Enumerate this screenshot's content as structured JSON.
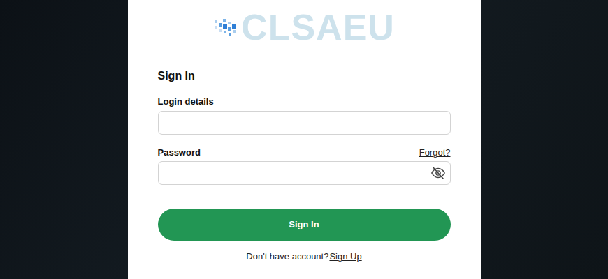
{
  "logo": {
    "text": "CLSAEU"
  },
  "sign_in": {
    "title": "Sign In",
    "login_label": "Login details",
    "login_value": "",
    "password_label": "Password",
    "forgot": "Forgot?",
    "password_visible": false,
    "button": "Sign In",
    "prompt": "Don't have account?",
    "signup": "Sign Up"
  }
}
